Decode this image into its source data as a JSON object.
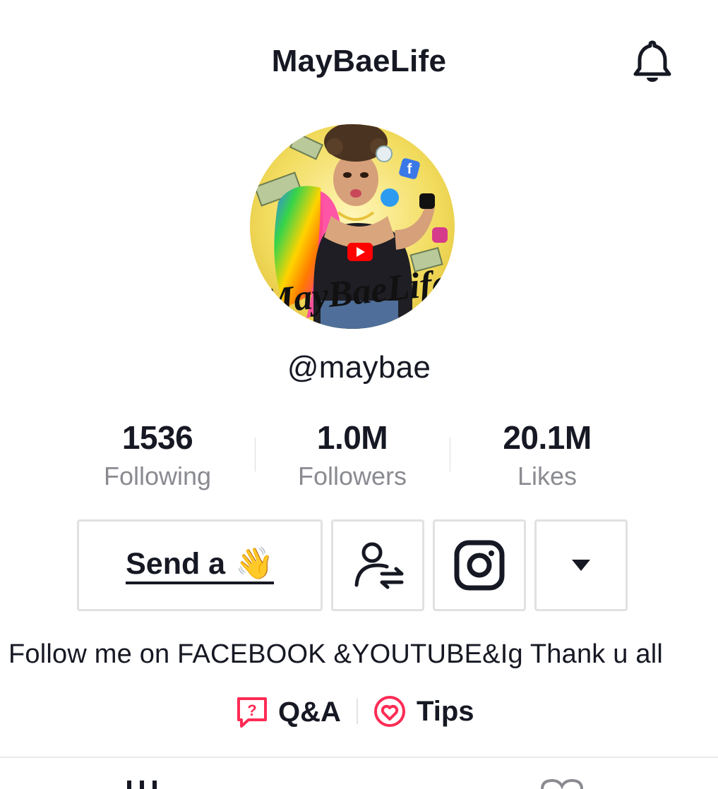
{
  "header": {
    "title": "MayBaeLife",
    "notification_icon": "bell-icon"
  },
  "profile": {
    "avatar_logo_text": "MayBaeLife",
    "handle": "@maybae"
  },
  "stats": [
    {
      "value": "1536",
      "label": "Following"
    },
    {
      "value": "1.0M",
      "label": "Followers"
    },
    {
      "value": "20.1M",
      "label": "Likes"
    }
  ],
  "actions": {
    "send_wave_label": "Send a",
    "send_wave_emoji": "👋",
    "friends_icon": "user-switch-icon",
    "instagram_icon": "instagram-icon",
    "more_icon": "caret-down-icon"
  },
  "bio": "Follow me on FACEBOOK &YOUTUBE&Ig Thank u all",
  "links": {
    "qa_label": "Q&A",
    "tips_label": "Tips"
  },
  "colors": {
    "text": "#161823",
    "muted": "#8a8b91",
    "accent": "#fe2c55",
    "border": "#e1e1e3"
  },
  "tabs": [
    "grid-icon",
    "liked-heart-icon"
  ]
}
